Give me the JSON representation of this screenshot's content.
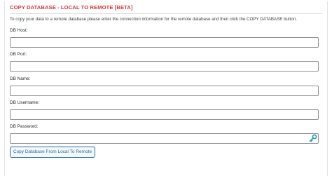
{
  "panel": {
    "title": "COPY DATABASE - LOCAL TO REMOTE [BETA]",
    "intro": "To copy your data to a remote database please enter the connection information for the remote database and then click the COPY DATABASE button."
  },
  "fields": [
    {
      "label": "DB Host:",
      "value": ""
    },
    {
      "label": "DB Port:",
      "value": ""
    },
    {
      "label": "DB Name:",
      "value": ""
    },
    {
      "label": "DB Username:",
      "value": ""
    },
    {
      "label": "DB Password:",
      "value": ""
    }
  ],
  "icons": {
    "password_reveal": "key-icon"
  },
  "copy_button": {
    "label": "Copy Database From Local To Remote"
  },
  "colors": {
    "title": "#d63638",
    "button_accent": "#2271b1",
    "key_icon": "#1e9bb8"
  }
}
